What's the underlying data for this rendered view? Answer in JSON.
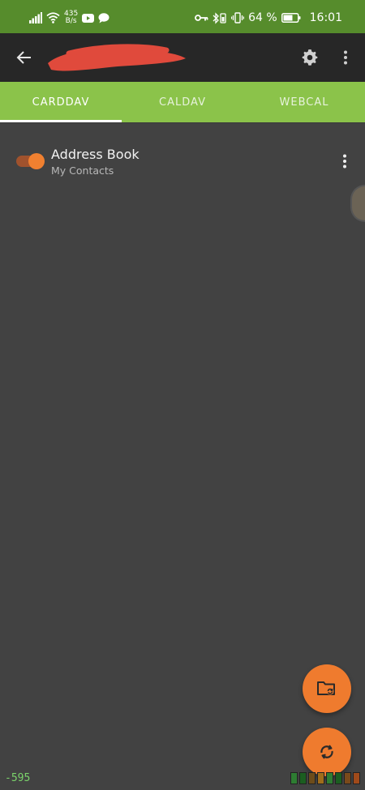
{
  "status_bar": {
    "net_speed_value": "435",
    "net_speed_unit": "B/s",
    "battery_percent": "64 %",
    "time": "16:01"
  },
  "toolbar": {
    "title": "m",
    "icons": {
      "back": "arrow-left-icon",
      "settings": "gear-icon",
      "overflow": "more-vert-icon"
    }
  },
  "tabs": [
    {
      "label": "CARDDAV",
      "active": true
    },
    {
      "label": "CALDAV",
      "active": false
    },
    {
      "label": "WEBCAL",
      "active": false
    }
  ],
  "collections": [
    {
      "title": "Address Book",
      "subtitle": "My Contacts",
      "enabled": true
    }
  ],
  "fabs": {
    "create_icon": "folder-sync-icon",
    "sync_icon": "sync-icon"
  },
  "debug": {
    "counter": "-595"
  },
  "colors": {
    "status_bar": "#568c2c",
    "toolbar": "#272727",
    "tabs": "#8bc34a",
    "background": "#424242",
    "accent": "#ef7b2e"
  }
}
